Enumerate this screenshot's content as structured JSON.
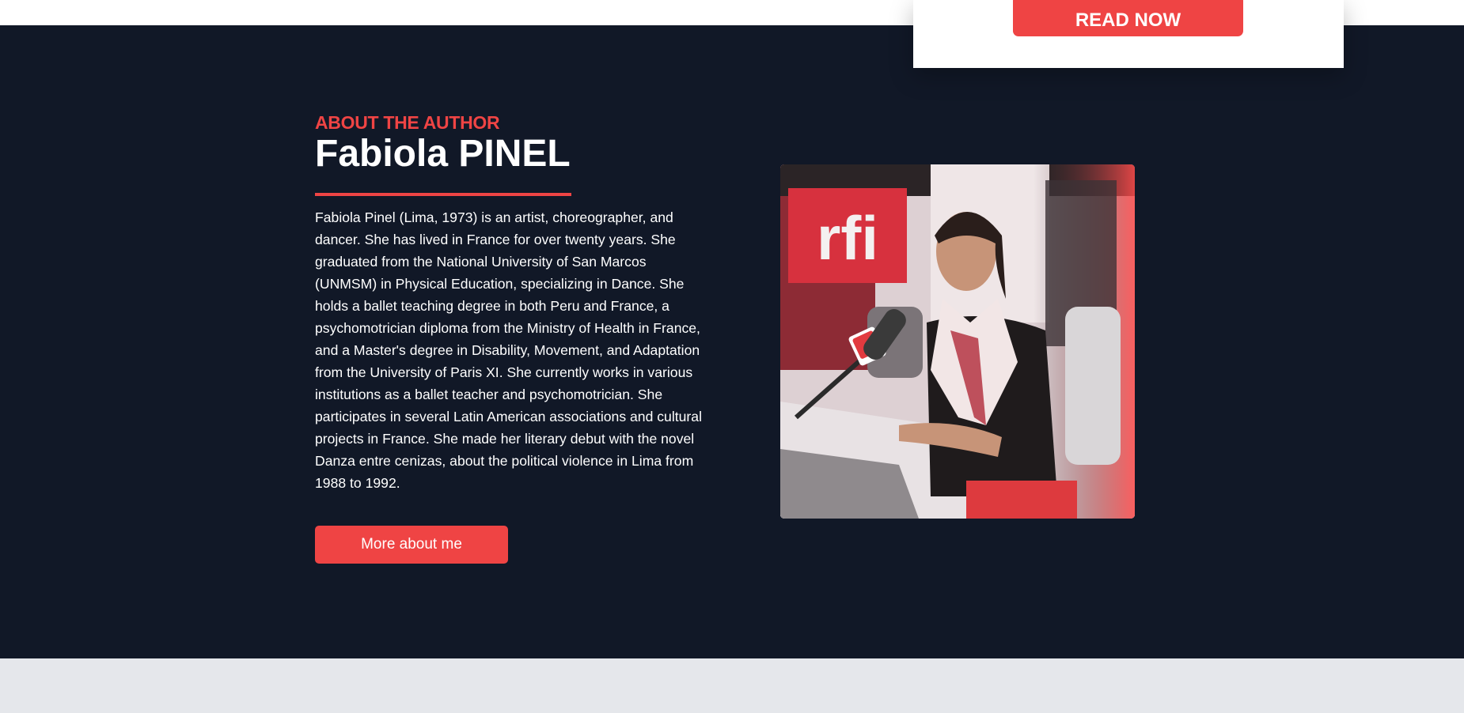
{
  "card": {
    "read_now_label": "READ NOW"
  },
  "about": {
    "eyebrow": "ABOUT THE AUTHOR",
    "name": "Fabiola PINEL",
    "bio": "Fabiola Pinel (Lima, 1973) is an artist, choreographer, and dancer. She has lived in France for over twenty years. She graduated from the National University of San Marcos (UNMSM) in Physical Education, specializing in Dance. She holds a ballet teaching degree in both Peru and France, a psychomotrician diploma from the Ministry of Health in France, and a Master's degree in Disability, Movement, and Adaptation from the University of Paris XI. She currently works in various institutions as a ballet teacher and psychomotrician. She participates in several Latin American associations and cultural projects in France. She made her literary debut with the novel Danza entre cenizas, about the political violence in Lima from 1988 to 1992.",
    "button_label": "More about me",
    "photo_logo": "rfi"
  },
  "colors": {
    "accent": "#ef4444",
    "dark_background": "#111827",
    "light_band": "#e5e7eb",
    "text_light": "#ffffff"
  }
}
